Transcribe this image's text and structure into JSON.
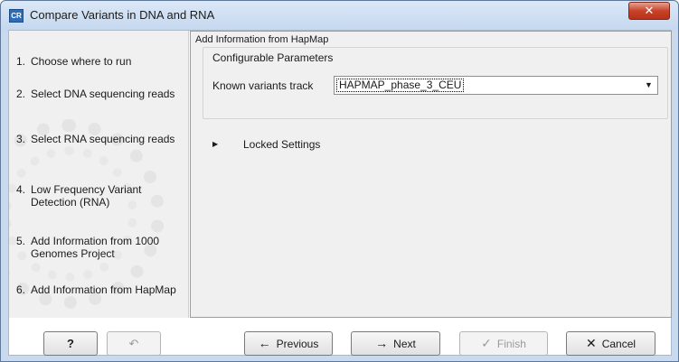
{
  "window": {
    "app_icon_text": "CR",
    "title": "Compare Variants in DNA and RNA",
    "close_glyph": "✕"
  },
  "steps": [
    {
      "num": "1.",
      "label": "Choose where to run"
    },
    {
      "num": "2.",
      "label": "Select DNA sequencing reads"
    },
    {
      "num": "3.",
      "label": "Select RNA sequencing reads"
    },
    {
      "num": "4.",
      "label": "Low Frequency Variant Detection (RNA)"
    },
    {
      "num": "5.",
      "label": "Add Information from 1000 Genomes Project"
    },
    {
      "num": "6.",
      "label": "Add Information from HapMap"
    }
  ],
  "main": {
    "header": "Add Information from HapMap",
    "params_title": "Configurable Parameters",
    "known_variants_label": "Known variants track",
    "known_variants_value": "HAPMAP_phase_3_CEU",
    "dropdown_glyph": "▼",
    "locked_glyph": "▶",
    "locked_label": "Locked Settings"
  },
  "buttons": {
    "help": "?",
    "undo_glyph": "↶",
    "previous_icon": "←",
    "previous": "Previous",
    "next_icon": "→",
    "next": "Next",
    "finish_icon": "✓",
    "finish": "Finish",
    "cancel_icon": "✕",
    "cancel": "Cancel"
  }
}
